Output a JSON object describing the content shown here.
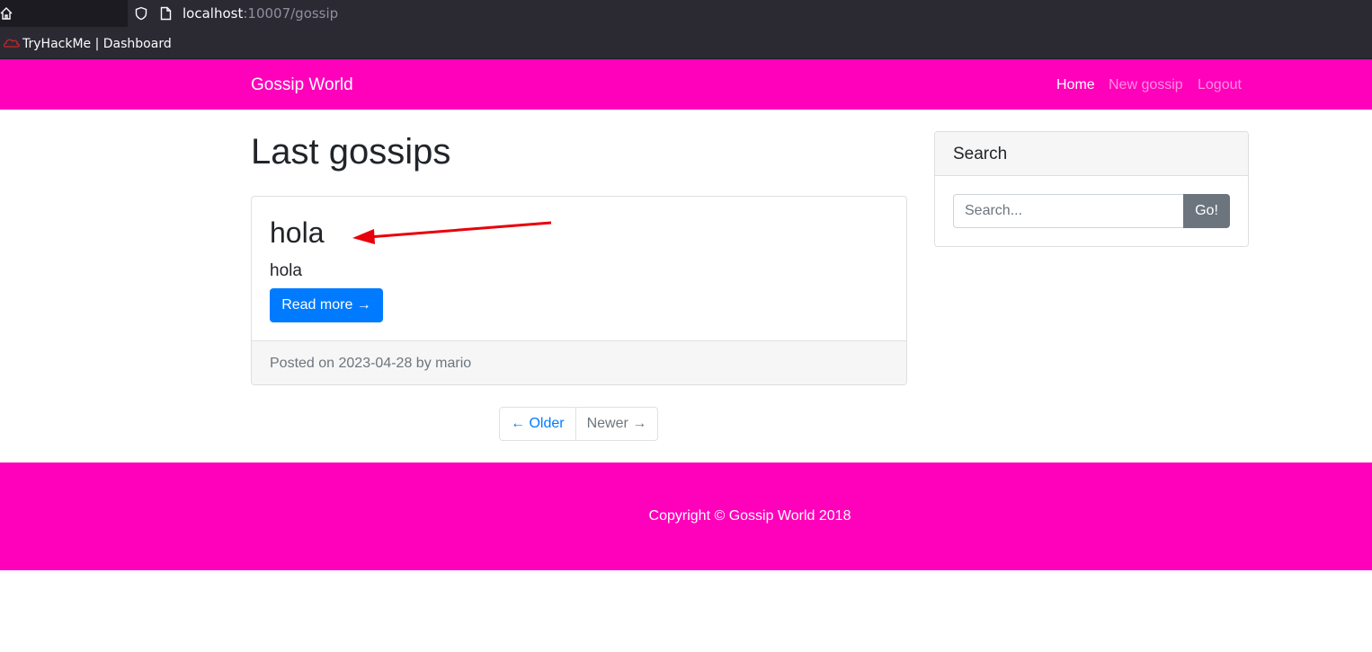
{
  "browser": {
    "url_host": "localhost",
    "url_path": ":10007/gossip",
    "bookmark_label": "TryHackMe | Dashboard"
  },
  "nav": {
    "brand": "Gossip World",
    "links": [
      {
        "label": "Home"
      },
      {
        "label": "New gossip"
      },
      {
        "label": "Logout"
      }
    ]
  },
  "main": {
    "page_title": "Last gossips",
    "post": {
      "title": "hola",
      "body": "hola",
      "read_more_label": "Read more →",
      "meta": "Posted on 2023-04-28 by mario"
    },
    "pager": {
      "older_label": "← Older",
      "newer_label": "Newer →"
    }
  },
  "sidebar": {
    "search_title": "Search",
    "search_placeholder": "Search...",
    "go_label": "Go!"
  },
  "footer": {
    "copyright": "Copyright © Gossip World 2018"
  },
  "colors": {
    "brand_pink": "#ff00bb",
    "primary_blue": "#007bff",
    "secondary_gray": "#6c757d",
    "annotation_red": "#e8000a"
  }
}
